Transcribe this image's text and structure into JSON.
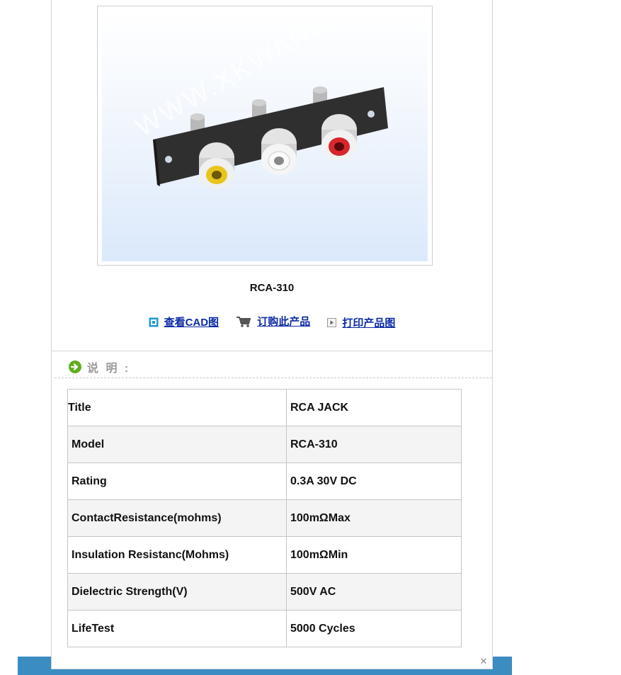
{
  "product": {
    "watermark": "WWW.XKWANDA.NET",
    "model_caption": "RCA-310"
  },
  "actions": [
    {
      "label": "查看CAD图",
      "icon": "cad-view-icon"
    },
    {
      "label": "订购此产品",
      "icon": "shopping-cart-icon"
    },
    {
      "label": "打印产品图",
      "icon": "play-arrow-icon"
    }
  ],
  "section": {
    "title": "说 明 :",
    "icon": "green-arrow-circle-icon"
  },
  "specs": [
    {
      "key": "Title",
      "value": "RCA JACK"
    },
    {
      "key": "Model",
      "value": "RCA-310"
    },
    {
      "key": "Rating",
      "value": "0.3A 30V DC"
    },
    {
      "key": "ContactResistance(mohms)",
      "value": "100mΩMax"
    },
    {
      "key": "Insulation Resistanc(Mohms)",
      "value": "100mΩMin"
    },
    {
      "key": "Dielectric Strength(V)",
      "value": "500V AC"
    },
    {
      "key": "LifeTest",
      "value": "5000 Cycles"
    }
  ],
  "colors": {
    "link": "#0b2ba6",
    "bottom_bar": "#3a8cc1",
    "section_icon": "#5fae1d"
  },
  "close_glyph": "✕"
}
